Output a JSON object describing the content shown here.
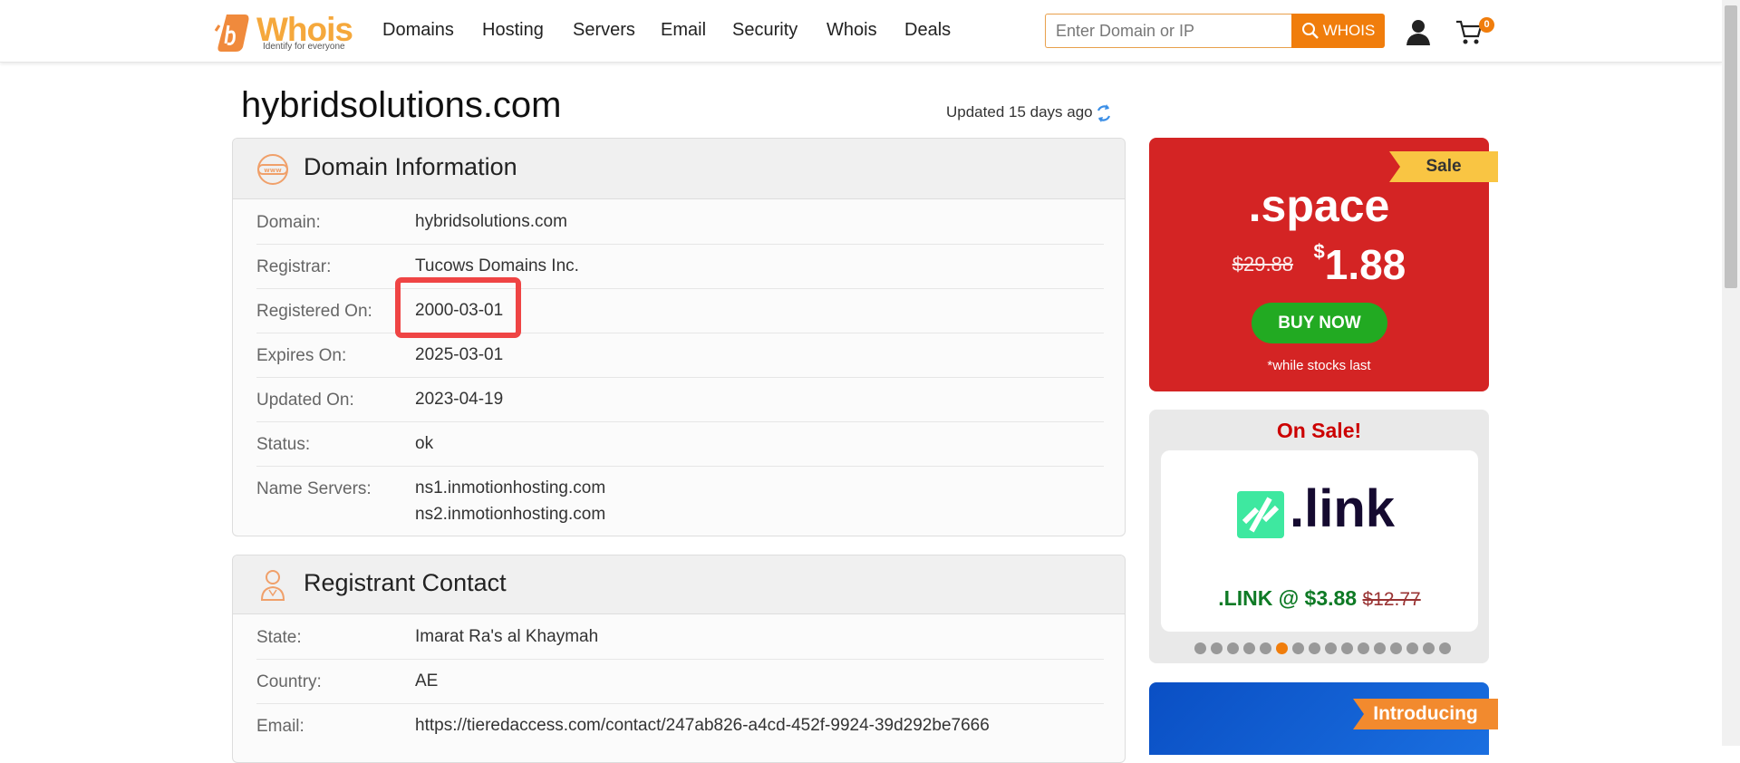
{
  "header": {
    "logo_text": "Whois",
    "logo_tagline": "Identify for everyone",
    "nav": [
      "Domains",
      "Hosting",
      "Servers",
      "Email",
      "Security",
      "Whois",
      "Deals"
    ],
    "search_placeholder": "Enter Domain or IP",
    "search_button": "WHOIS",
    "cart_count": "0",
    "accent": "#f07d0c"
  },
  "page": {
    "title": "hybridsolutions.com",
    "updated": "Updated 15 days ago"
  },
  "domain_info": {
    "heading": "Domain Information",
    "rows": [
      {
        "label": "Domain:",
        "value": "hybridsolutions.com"
      },
      {
        "label": "Registrar:",
        "value": "Tucows Domains Inc."
      },
      {
        "label": "Registered On:",
        "value": "2000-03-01"
      },
      {
        "label": "Expires On:",
        "value": "2025-03-01"
      },
      {
        "label": "Updated On:",
        "value": "2023-04-19"
      },
      {
        "label": "Status:",
        "value": "ok"
      },
      {
        "label": "Name Servers:",
        "value": "ns1.inmotionhosting.com",
        "value2": "ns2.inmotionhosting.com"
      }
    ]
  },
  "registrant": {
    "heading": "Registrant Contact",
    "rows": [
      {
        "label": "State:",
        "value": "Imarat Ra's al Khaymah"
      },
      {
        "label": "Country:",
        "value": "AE"
      },
      {
        "label": "Email:",
        "value": "https://tieredaccess.com/contact/247ab826-a4cd-452f-9924-39d292be7666"
      }
    ]
  },
  "promo1": {
    "ribbon": "Sale",
    "tld": ".space",
    "old_price": "$29.88",
    "currency": "$",
    "price": "1.88",
    "button": "BUY NOW",
    "note": "*while stocks last"
  },
  "promo2": {
    "heading": "On Sale!",
    "logo_text": ".link",
    "offer": ".LINK @ $3.88",
    "old_price": "$12.77",
    "slide_count": 16,
    "active_slide": 6
  },
  "promo3": {
    "ribbon": "Introducing"
  }
}
